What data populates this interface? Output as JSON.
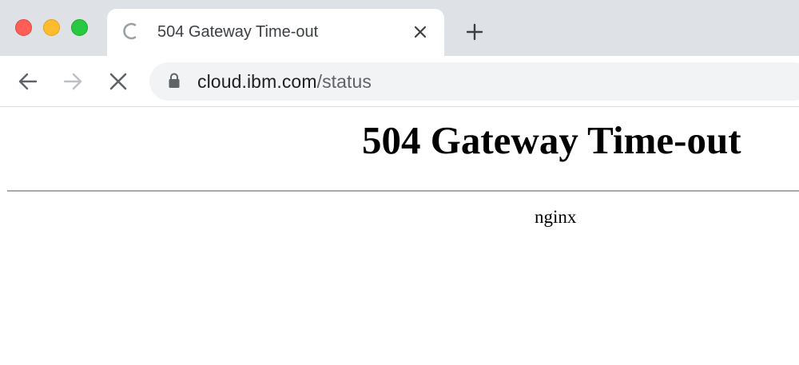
{
  "window": {
    "controls": [
      "close",
      "minimize",
      "maximize"
    ]
  },
  "tab": {
    "title": "504 Gateway Time-out",
    "loading_icon": "loading-spinner-icon",
    "close_icon": "close-icon"
  },
  "new_tab": {
    "icon": "plus-icon"
  },
  "toolbar": {
    "back_icon": "arrow-left-icon",
    "forward_icon": "arrow-right-icon",
    "stop_icon": "close-icon"
  },
  "address_bar": {
    "host": "cloud.ibm.com",
    "path": "/status",
    "lock_icon": "lock-icon"
  },
  "page": {
    "heading": "504 Gateway Time-out",
    "server": "nginx"
  },
  "colors": {
    "tabstrip_bg": "#dee1e6",
    "omnibox_bg": "#f1f3f4",
    "traffic_close": "#ff5f57",
    "traffic_minimize": "#febc2e",
    "traffic_maximize": "#28c840"
  }
}
